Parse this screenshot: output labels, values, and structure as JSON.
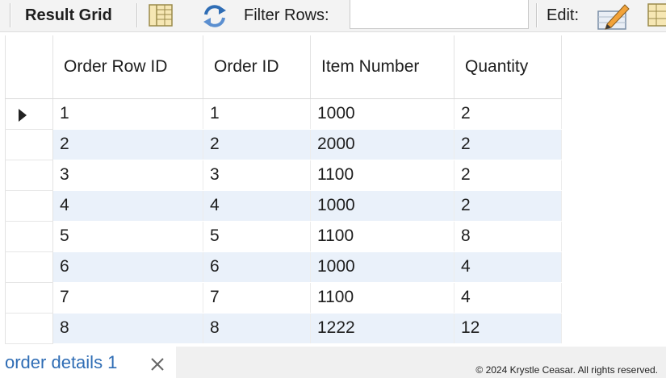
{
  "toolbar": {
    "result_grid_label": "Result Grid",
    "filter_rows_label": "Filter Rows:",
    "filter_value": "",
    "edit_label": "Edit:",
    "icons": [
      "grid-layout-icon",
      "refresh-icon",
      "edit-pencil-icon",
      "table-icon"
    ]
  },
  "grid": {
    "columns": [
      "Order Row ID",
      "Order ID",
      "Item Number",
      "Quantity"
    ],
    "rows": [
      [
        "1",
        "1",
        "1000",
        "2"
      ],
      [
        "2",
        "2",
        "2000",
        "2"
      ],
      [
        "3",
        "3",
        "1100",
        "2"
      ],
      [
        "4",
        "4",
        "1000",
        "2"
      ],
      [
        "5",
        "5",
        "1100",
        "8"
      ],
      [
        "6",
        "6",
        "1000",
        "4"
      ],
      [
        "7",
        "7",
        "1100",
        "4"
      ],
      [
        "8",
        "8",
        "1222",
        "12"
      ]
    ],
    "current_row_index": 0
  },
  "tabs": [
    {
      "label": "order details 1",
      "active": true
    }
  ],
  "footer": {
    "copyright": "© 2024 Krystle Ceasar. All rights reserved."
  },
  "colors": {
    "alt_row": "#eaf1fa",
    "tab_text": "#2f6db5",
    "toolbar_bg": "#f3f3f3"
  }
}
